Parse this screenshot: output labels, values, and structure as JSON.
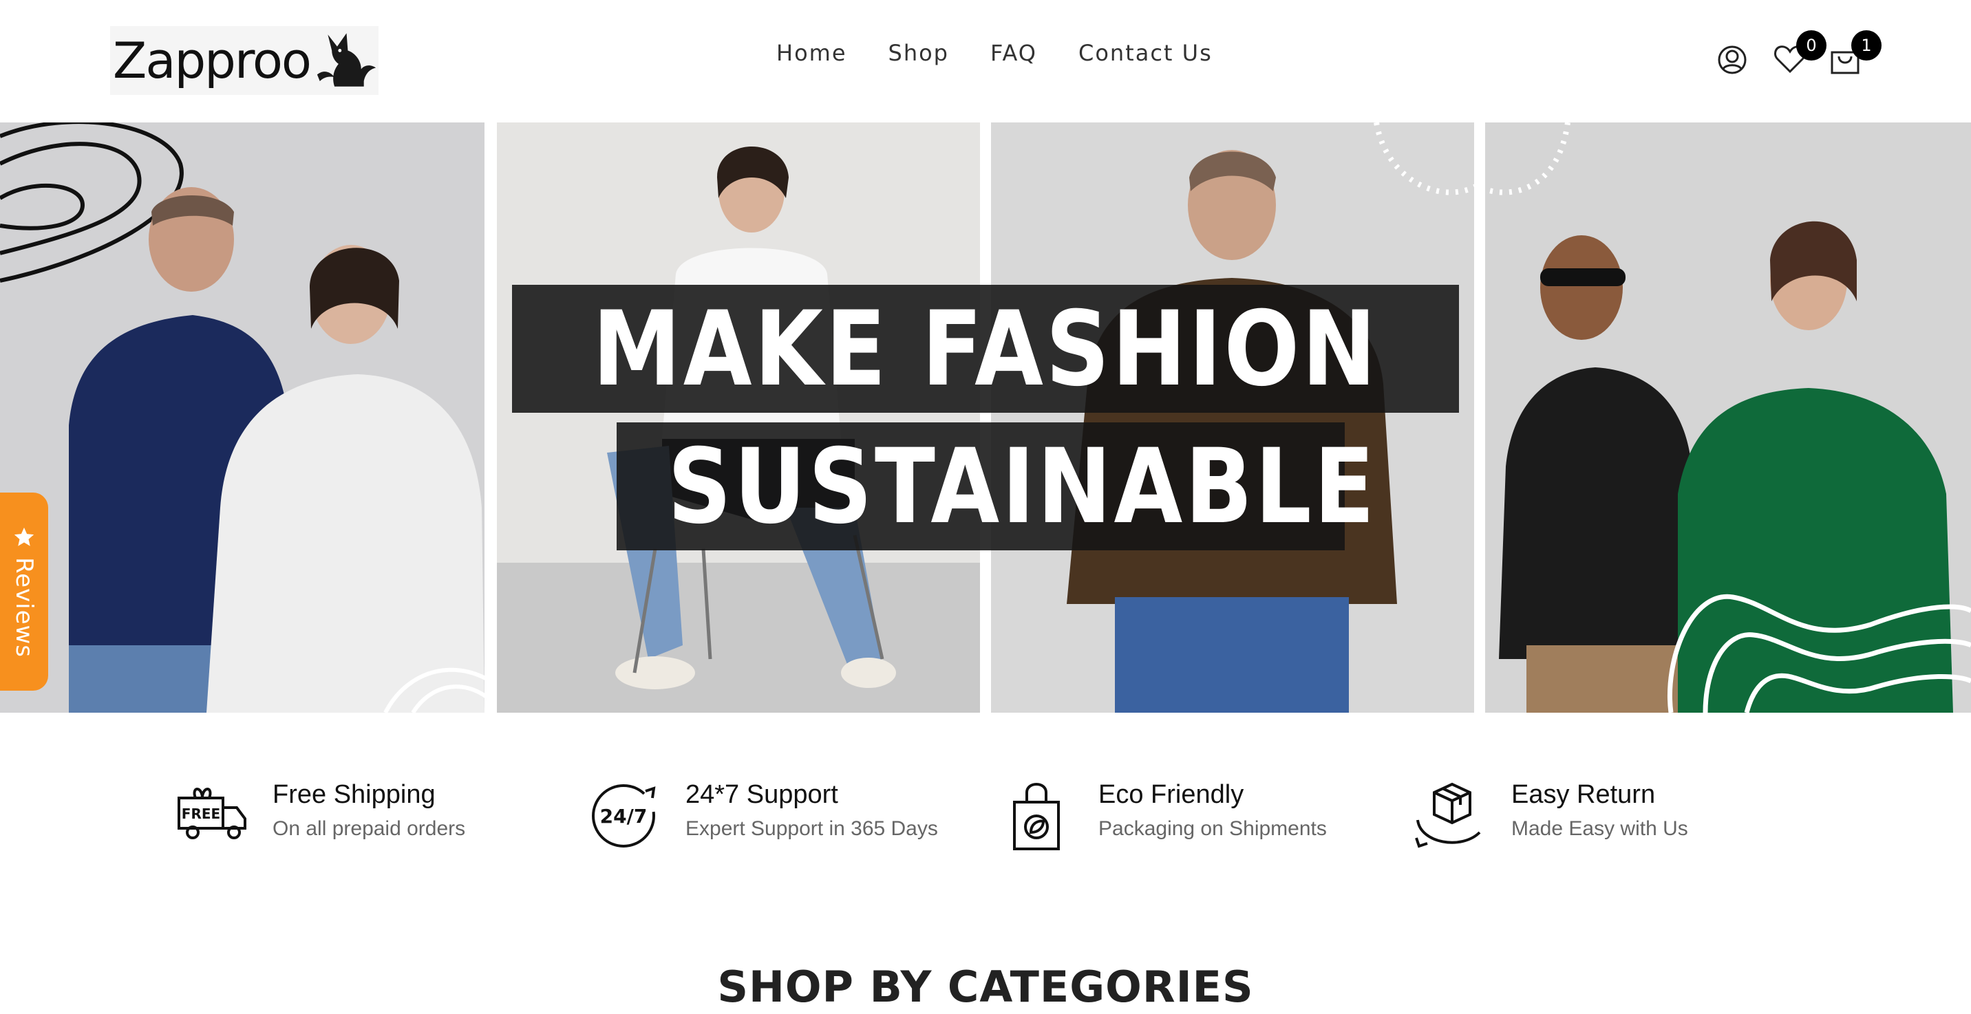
{
  "brand": {
    "name": "Zapproo",
    "logo_icon": "fox-icon"
  },
  "nav": {
    "items": [
      "Home",
      "Shop",
      "FAQ",
      "Contact Us"
    ]
  },
  "header_icons": {
    "account_icon": "user-icon",
    "wishlist_icon": "heart-icon",
    "wishlist_count": "0",
    "cart_icon": "shopping-bag-icon",
    "cart_count": "1"
  },
  "hero": {
    "line1": "MAKE FASHION",
    "line2": "SUSTAINABLE",
    "panels": [
      "man-in-navy-sweatshirt-and-woman-in-white-sweatshirt",
      "woman-in-white-sweatshirt-seated-on-chair",
      "man-in-brown-sweatshirt",
      "man-in-black-hoodie-and-woman-in-green-hoodie"
    ]
  },
  "reviews_tab": {
    "label": "Reviews",
    "icon": "star-icon",
    "color": "#f7901e"
  },
  "features": [
    {
      "icon": "free-delivery-truck-icon",
      "icon_text": "FREE",
      "title": "Free Shipping",
      "subtitle": "On all prepaid orders"
    },
    {
      "icon": "support-24-7-icon",
      "icon_text": "24/7",
      "title": "24*7 Support",
      "subtitle": "Expert Support in 365 Days"
    },
    {
      "icon": "eco-bag-icon",
      "title": "Eco Friendly",
      "subtitle": "Packaging on Shipments"
    },
    {
      "icon": "return-box-icon",
      "title": "Easy Return",
      "subtitle": "Made Easy with Us"
    }
  ],
  "section": {
    "title": "SHOP BY CATEGORIES"
  }
}
